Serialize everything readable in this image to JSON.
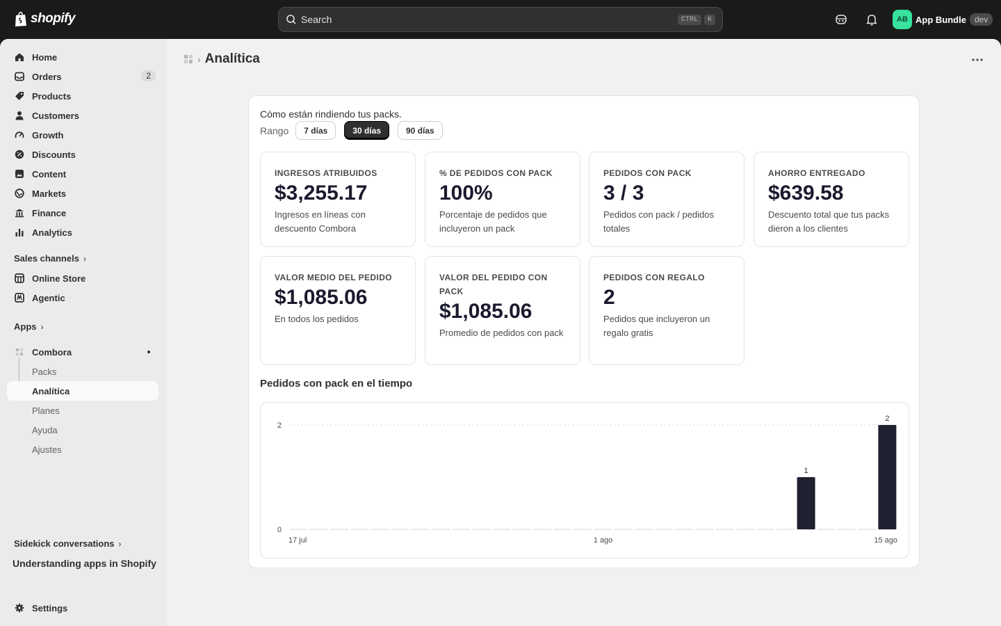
{
  "topbar": {
    "brand": "shopify",
    "search_placeholder": "Search",
    "search_kbd_1": "CTRL",
    "search_kbd_2": "K",
    "account_initials": "AB",
    "account_name": "App Bundle",
    "account_badge": "dev",
    "avatar_color": "#36e29c"
  },
  "sidebar": {
    "items": [
      {
        "label": "Home",
        "icon": "home-icon"
      },
      {
        "label": "Orders",
        "icon": "inbox-icon",
        "badge": "2"
      },
      {
        "label": "Products",
        "icon": "tag-icon"
      },
      {
        "label": "Customers",
        "icon": "person-icon"
      },
      {
        "label": "Growth",
        "icon": "gauge-icon"
      },
      {
        "label": "Discounts",
        "icon": "discount-icon"
      },
      {
        "label": "Content",
        "icon": "content-icon"
      },
      {
        "label": "Markets",
        "icon": "globe-icon"
      },
      {
        "label": "Finance",
        "icon": "bank-icon"
      },
      {
        "label": "Analytics",
        "icon": "bar-chart-icon"
      }
    ],
    "sales_channels_label": "Sales channels",
    "channels": [
      {
        "label": "Online Store",
        "icon": "store-icon"
      },
      {
        "label": "Agentic",
        "icon": "agentic-icon"
      }
    ],
    "apps_label": "Apps",
    "app_name": "Combora",
    "app_subitems": [
      "Packs",
      "Analítica",
      "Planes",
      "Ayuda",
      "Ajustes"
    ],
    "active_subitem": "Analítica",
    "sidekick_label": "Sidekick conversations",
    "sidekick_item": "Understanding apps in Shopify",
    "settings_label": "Settings"
  },
  "page": {
    "title": "Analítica",
    "intro": "Cómo están rindiendo tus packs.",
    "range_label": "Rango",
    "ranges": [
      "7 días",
      "30 días",
      "90 días"
    ],
    "selected_range": "30 días"
  },
  "stats": [
    {
      "title": "INGRESOS ATRIBUIDOS",
      "value": "$3,255.17",
      "desc": "Ingresos en líneas con descuento Combora"
    },
    {
      "title": "% DE PEDIDOS CON PACK",
      "value": "100%",
      "desc": "Porcentaje de pedidos que incluyeron un pack"
    },
    {
      "title": "PEDIDOS CON PACK",
      "value": "3 / 3",
      "desc": "Pedidos con pack / pedidos totales"
    },
    {
      "title": "AHORRO ENTREGADO",
      "value": "$639.58",
      "desc": "Descuento total que tus packs dieron a los clientes"
    },
    {
      "title": "VALOR MEDIO DEL PEDIDO",
      "value": "$1,085.06",
      "desc": "En todos los pedidos"
    },
    {
      "title": "VALOR DEL PEDIDO CON PACK",
      "value": "$1,085.06",
      "desc": "Promedio de pedidos con pack"
    },
    {
      "title": "PEDIDOS CON REGALO",
      "value": "2",
      "desc": "Pedidos que incluyeron un regalo gratis"
    }
  ],
  "chart_data": {
    "type": "bar",
    "title": "Pedidos con pack en el tiempo",
    "x_tick_labels": [
      "17 jul",
      "1 ago",
      "15 ago"
    ],
    "y_ticks": [
      0,
      2
    ],
    "ylim": [
      0,
      2
    ],
    "grid": true,
    "categories": [
      "17 jul",
      "18 jul",
      "19 jul",
      "20 jul",
      "21 jul",
      "22 jul",
      "23 jul",
      "24 jul",
      "25 jul",
      "26 jul",
      "27 jul",
      "28 jul",
      "29 jul",
      "30 jul",
      "31 jul",
      "1 ago",
      "2 ago",
      "3 ago",
      "4 ago",
      "5 ago",
      "6 ago",
      "7 ago",
      "8 ago",
      "9 ago",
      "10 ago",
      "11 ago",
      "12 ago",
      "13 ago",
      "14 ago",
      "15 ago"
    ],
    "values": [
      0,
      0,
      0,
      0,
      0,
      0,
      0,
      0,
      0,
      0,
      0,
      0,
      0,
      0,
      0,
      0,
      0,
      0,
      0,
      0,
      0,
      0,
      0,
      0,
      0,
      1,
      0,
      0,
      0,
      2
    ],
    "bar_color": "#1f2030"
  }
}
